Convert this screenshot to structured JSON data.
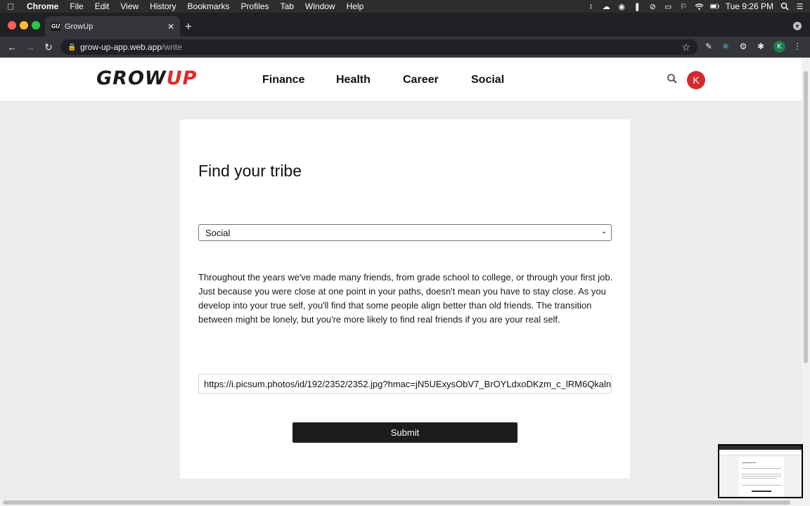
{
  "menubar": {
    "app": "Chrome",
    "items": [
      "File",
      "Edit",
      "View",
      "History",
      "Bookmarks",
      "Profiles",
      "Tab",
      "Window",
      "Help"
    ],
    "clock": "Tue 9:26 PM"
  },
  "browser": {
    "tab_title": "GrowUp",
    "tab_favicon": "GU",
    "url_host": "grow-up-app.web.app",
    "url_path": "/write",
    "profile_initial": "K"
  },
  "site": {
    "logo_part1": "GROW",
    "logo_part2": "UP",
    "nav": [
      "Finance",
      "Health",
      "Career",
      "Social"
    ],
    "avatar_initial": "K",
    "colors": {
      "accent": "#e02a2a",
      "dark": "#1c1c1c"
    }
  },
  "form": {
    "title": "Find your tribe",
    "category_selected": "Social",
    "body": "Throughout the years we've made many friends, from grade school to college, or through your first job. Just because you were close at one point in your paths, doesn't mean you have to stay close. As you develop into your true self, you'll find that some people align better than old friends. The transition between might be lonely, but you're more likely to find real friends if you are your real self.",
    "image_url": "https://i.picsum.photos/id/192/2352/2352.jpg?hmac=jN5UExysObV7_BrOYLdxoDKzm_c_lRM6Qkaln",
    "submit_label": "Submit"
  }
}
